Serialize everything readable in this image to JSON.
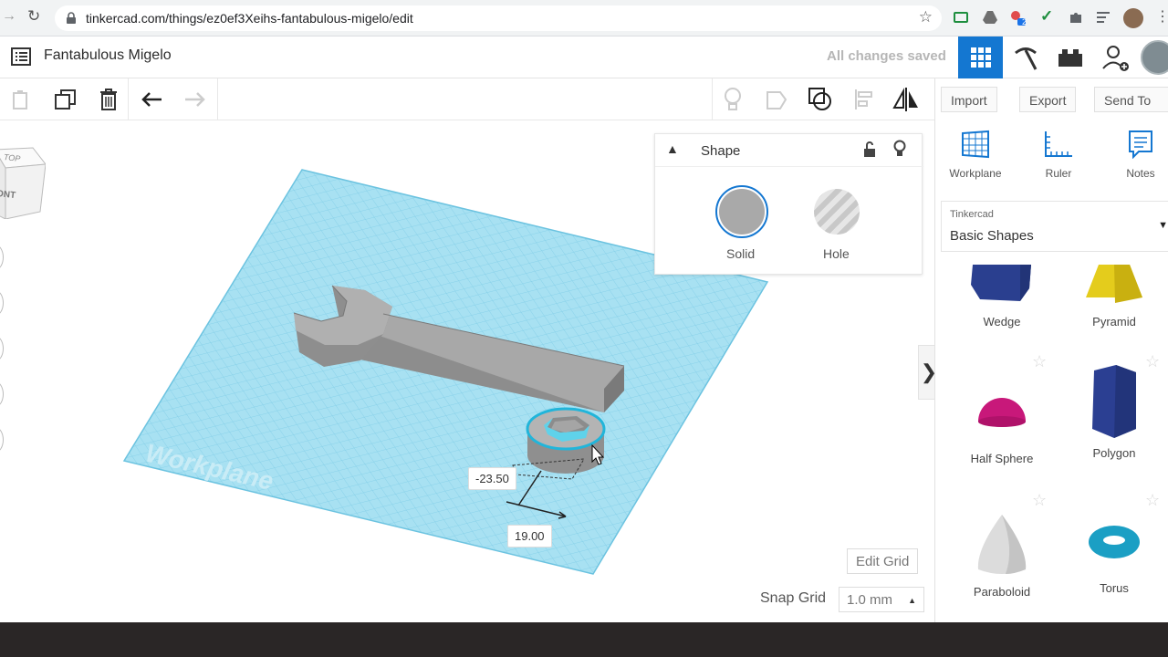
{
  "browser": {
    "url": "tinkercad.com/things/ez0ef3Xeihs-fantabulous-migelo/edit",
    "ext_badge": "2"
  },
  "header": {
    "title": "Fantabulous Migelo",
    "status": "All changes saved"
  },
  "right_panel": {
    "import_label": "Import",
    "export_label": "Export",
    "send_to_label": "Send To",
    "tools": {
      "workplane": "Workplane",
      "ruler": "Ruler",
      "notes": "Notes"
    },
    "library": {
      "source": "Tinkercad",
      "selected": "Basic Shapes"
    },
    "shapes": [
      {
        "label": "Wedge"
      },
      {
        "label": "Pyramid"
      },
      {
        "label": "Half Sphere"
      },
      {
        "label": "Polygon"
      },
      {
        "label": "Paraboloid"
      },
      {
        "label": "Torus"
      }
    ]
  },
  "inspector": {
    "title": "Shape",
    "solid_label": "Solid",
    "hole_label": "Hole"
  },
  "workspace": {
    "workplane_watermark": "Workplane",
    "dim_x": "-23.50",
    "dim_y": "19.00",
    "view_cube_top": "TOP",
    "view_cube_front": "ONT",
    "edit_grid_label": "Edit Grid",
    "snap_grid_label": "Snap Grid",
    "snap_grid_value": "1.0 mm"
  },
  "colors": {
    "accent": "#1477d1",
    "workplane": "#9fdcef",
    "grid_line": "#6cc3e0",
    "shape_gray": "#9a9a9a",
    "selection": "#20b4d8"
  }
}
